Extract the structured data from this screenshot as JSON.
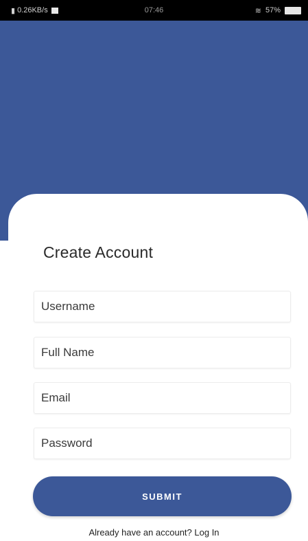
{
  "status_bar": {
    "left_text": "0.26KB/s",
    "time": "07:46",
    "right_text": "57%"
  },
  "form": {
    "title": "Create Account",
    "username_placeholder": "Username",
    "fullname_placeholder": "Full Name",
    "email_placeholder": "Email",
    "password_placeholder": "Password",
    "submit_label": "SUBMIT"
  },
  "footer": {
    "prompt": "Already have an account?",
    "login_link": "Log In"
  },
  "colors": {
    "primary": "#3c5898",
    "status_bar": "#000000",
    "background": "#ffffff"
  },
  "icons": [
    "signal-icon",
    "notification-icon",
    "wifi-icon",
    "battery-icon"
  ]
}
